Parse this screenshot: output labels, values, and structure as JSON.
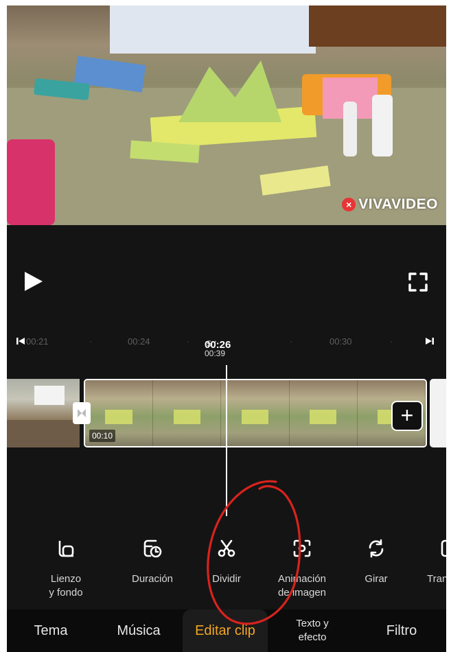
{
  "preview": {
    "watermark_text": "VIVAVIDEO",
    "watermark_badge": "×"
  },
  "controls": {
    "play_icon": "play-icon",
    "fullscreen_icon": "fullscreen-icon"
  },
  "ruler": {
    "marks": [
      "00:21",
      "00:24",
      "00:30"
    ],
    "current_time": "00:26",
    "current_fraction": ".5 / 00:39"
  },
  "clip": {
    "duration": "00:10",
    "add_label": "+"
  },
  "tools": [
    {
      "label": "Lienzo\ny fondo",
      "icon": "canvas-icon"
    },
    {
      "label": "Duración",
      "icon": "duration-icon"
    },
    {
      "label": "Dividir",
      "icon": "scissors-icon"
    },
    {
      "label": "Animación\nde imagen",
      "icon": "animation-icon"
    },
    {
      "label": "Girar",
      "icon": "rotate-icon"
    },
    {
      "label": "Tran",
      "icon": "transform-icon"
    }
  ],
  "nav": {
    "items": [
      "Tema",
      "Música",
      "Editar clip",
      "Texto y\nefecto",
      "Filtro"
    ],
    "active": "Editar clip"
  },
  "colors": {
    "accent": "#f5a623",
    "annotation": "#d8231d",
    "background": "#141414"
  }
}
